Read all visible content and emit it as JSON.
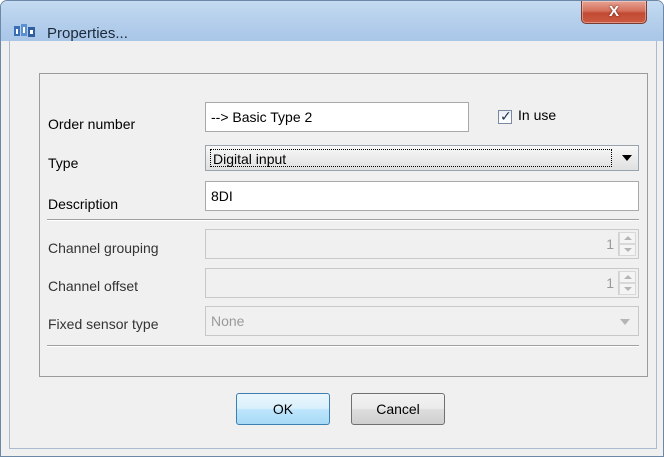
{
  "window": {
    "title": "Properties...",
    "close_label": "X"
  },
  "form": {
    "order_number": {
      "label": "Order number",
      "value": "--> Basic Type 2"
    },
    "in_use": {
      "label": "In use",
      "checked": true
    },
    "type": {
      "label": "Type",
      "value": "Digital input"
    },
    "description": {
      "label": "Description",
      "value": "8DI"
    },
    "channel_grouping": {
      "label": "Channel grouping",
      "value": "1"
    },
    "channel_offset": {
      "label": "Channel offset",
      "value": "1"
    },
    "fixed_sensor_type": {
      "label": "Fixed sensor type",
      "value": "None"
    }
  },
  "buttons": {
    "ok": "OK",
    "cancel": "Cancel"
  },
  "icons": {
    "app": "app-icon",
    "close": "close-icon",
    "checkbox": "checkmark-icon"
  }
}
